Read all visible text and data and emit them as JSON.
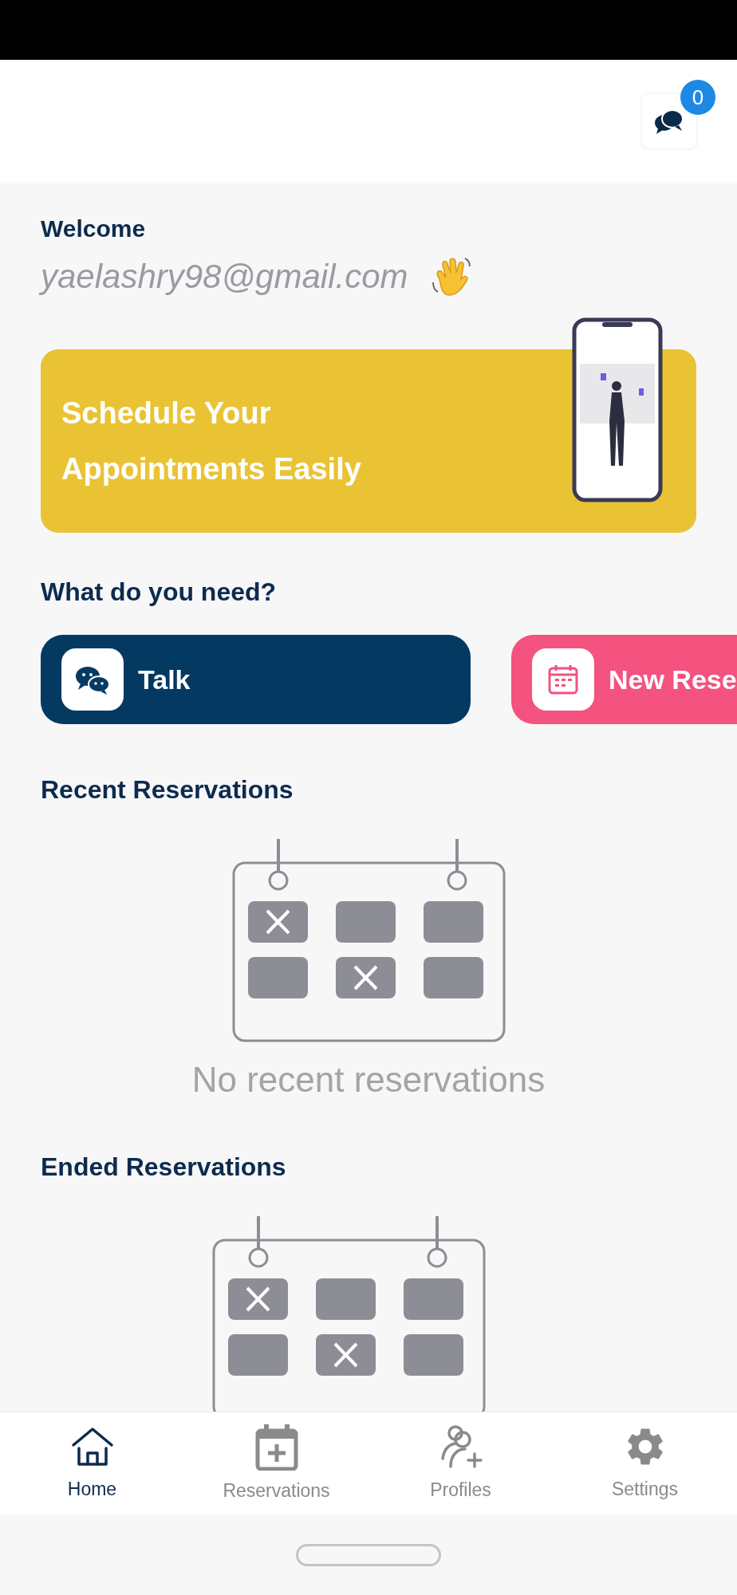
{
  "header": {
    "chat_badge": "0"
  },
  "welcome": {
    "title": "Welcome",
    "email": "yaelashry98@gmail.com"
  },
  "banner": {
    "lines": [
      "Schedule Your",
      "Appointments Easily"
    ]
  },
  "needs": {
    "title": "What do you need?",
    "actions": [
      {
        "kind": "talk",
        "label": "Talk"
      },
      {
        "kind": "new_reservation",
        "label": "New Rese"
      }
    ]
  },
  "sections": [
    {
      "title": "Recent Reservations",
      "empty_text": "No recent reservations"
    },
    {
      "title": "Ended Reservations"
    }
  ],
  "nav": [
    {
      "kind": "home",
      "label": "Home",
      "selected": true
    },
    {
      "kind": "reservations",
      "label": "Reservations",
      "selected": false
    },
    {
      "kind": "profiles",
      "label": "Profiles",
      "selected": false
    },
    {
      "kind": "settings",
      "label": "Settings",
      "selected": false
    }
  ]
}
